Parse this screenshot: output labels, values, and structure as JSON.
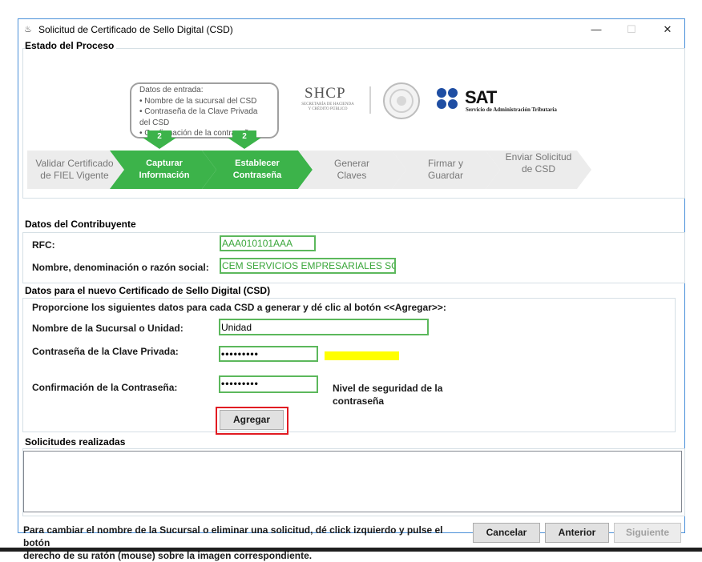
{
  "window": {
    "title": "Solicitud de Certificado de Sello Digital (CSD)",
    "minimize": "—",
    "maximize": "☐",
    "close": "✕"
  },
  "proceso": {
    "legend": "Estado del Proceso",
    "bubble_lines": [
      "Datos de entrada:",
      "• Nombre de la sucursal del CSD",
      "• Contraseña de la Clave Privada",
      "del CSD",
      "• Confirmación de la contraseña"
    ],
    "badge_number": "2",
    "shcp": {
      "name": "SHCP",
      "line1": "SECRETARÍA DE HACIENDA",
      "line2": "Y CRÉDITO PÚBLICO"
    },
    "sat": {
      "name": "SAT",
      "subtitle": "Servicio de Administración Tributaria"
    },
    "steps": [
      {
        "label": "Validar Certificado de FIEL Vigente",
        "state": "done"
      },
      {
        "label": "Capturar Información",
        "state": "active"
      },
      {
        "label": "Establecer Contraseña",
        "state": "active"
      },
      {
        "label": "Generar Claves",
        "state": "pending"
      },
      {
        "label": "Firmar y Guardar",
        "state": "pending"
      },
      {
        "label": "Enviar Solicitud de CSD",
        "state": "pending"
      }
    ],
    "colors": {
      "active": "#3cb34a",
      "pending": "#ececec",
      "active_text": "#ffffff",
      "pending_text": "#777777"
    }
  },
  "contribuyente": {
    "legend": "Datos del Contribuyente",
    "rfc_label": "RFC:",
    "rfc_value": "AAA010101AAA",
    "nombre_label": "Nombre, denominación o razón social:",
    "nombre_value": "CEM SERVICIOS EMPRESARIALES SC"
  },
  "csd": {
    "legend": "Datos para el nuevo Certificado de Sello Digital (CSD)",
    "instruction": "Proporcione los siguientes datos para cada CSD a generar y dé clic al botón <<Agregar>>:",
    "sucursal_label": "Nombre de la Sucursal o Unidad:",
    "sucursal_value": "Unidad",
    "password_label": "Contraseña de la Clave Privada:",
    "password_value": "•••••••••",
    "confirm_label": "Confirmación de la Contraseña:",
    "confirm_value": "•••••••••",
    "security_label": "Nivel de seguridad de la contraseña",
    "security_color": "#ffff00",
    "add_button": "Agregar"
  },
  "solicitudes": {
    "legend": "Solicitudes realizadas"
  },
  "footer": {
    "help_line1": "Para cambiar el nombre de la Sucursal o eliminar una solicitud, dé click izquierdo y pulse el botón",
    "help_line2": "derecho de su ratón (mouse) sobre la imagen correspondiente.",
    "cancel_button": "Cancelar",
    "back_button": "Anterior",
    "next_button": "Siguiente"
  }
}
